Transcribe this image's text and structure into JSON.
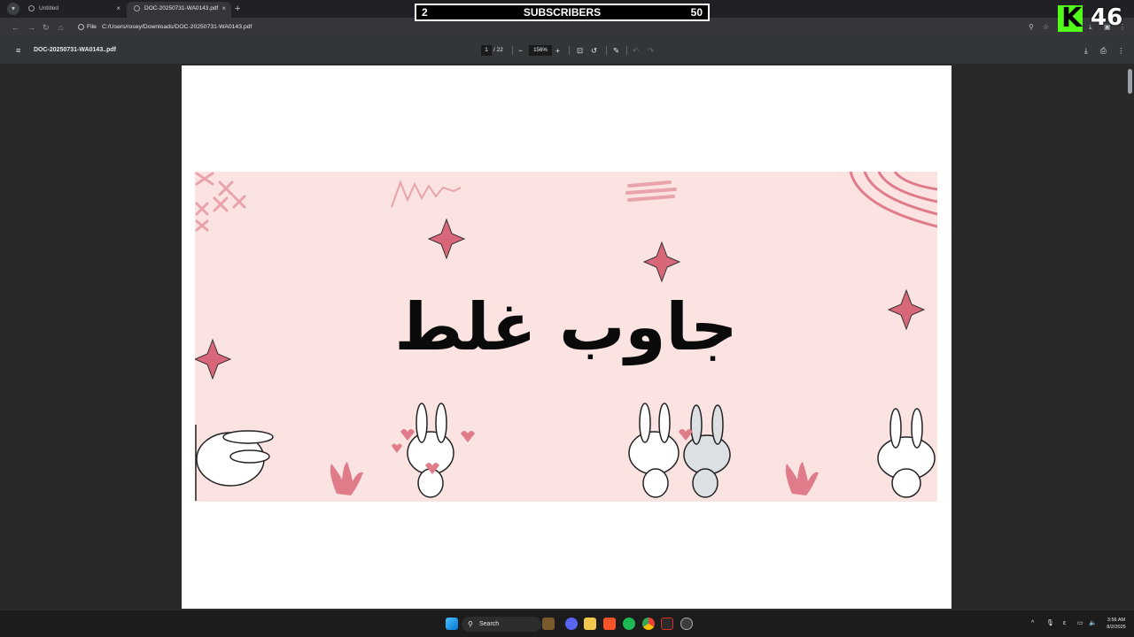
{
  "browser": {
    "tabs": [
      {
        "title": "Untitled",
        "active": false
      },
      {
        "title": "DOC-20250731-WA0143.pdf",
        "active": true
      }
    ],
    "new_tab_glyph": "+",
    "close_glyph": "×",
    "address": {
      "chip": "File",
      "url": "C:/Users/rosey/Downloads/DOC-20250731-WA0143.pdf"
    }
  },
  "pdf_toolbar": {
    "file_name": "DOC-20250731-WA0143..pdf",
    "current_page": "1",
    "total_pages": "/ 22",
    "zoom": "156%",
    "zoom_out": "−",
    "zoom_in": "+"
  },
  "slide": {
    "title": "جاوب غلط"
  },
  "overlay": {
    "subscribers_left": "2",
    "subscribers_label": "SUBSCRIBERS",
    "subscribers_right": "50",
    "kick_letter": "K",
    "kick_count": "46",
    "kick_color": "#53fc18"
  },
  "taskbar": {
    "search_label": "Search",
    "time": "3:56 AM",
    "date": "8/2/2025"
  }
}
